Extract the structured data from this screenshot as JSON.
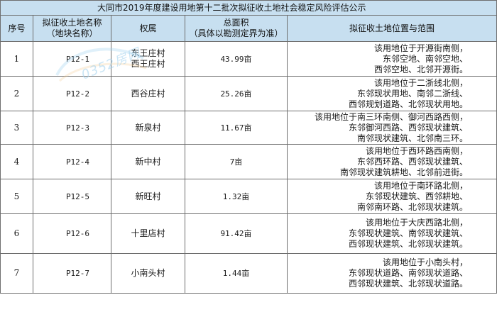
{
  "title": "大同市2019年度建设用地第十二批次拟征收土地社会稳定风险评估公示",
  "headers": {
    "no": "序号",
    "name_line1": "拟征收土地名称",
    "name_line2": "（地块名称）",
    "owner": "权属",
    "area_line1": "总面积",
    "area_line2": "（具体以勘测定界为准）",
    "location": "拟征收土地位置与范围"
  },
  "rows": [
    {
      "no": "1",
      "code": "P12-1",
      "villages": [
        "东王庄村",
        "西王庄村"
      ],
      "area": "43.99亩",
      "location": [
        "该用地位于开源街南侧，",
        "东邻空地、南邻空地、",
        "西邻空地、北邻开源街。"
      ]
    },
    {
      "no": "2",
      "code": "P12-2",
      "villages": [
        "西谷庄村"
      ],
      "area": "25.26亩",
      "location": [
        "该用地位于二浙线北侧，",
        "东邻现状用地、南邻二浙线、",
        "西邻规划道路、北邻现状用地。"
      ]
    },
    {
      "no": "3",
      "code": "P12-3",
      "villages": [
        "新泉村"
      ],
      "area": "11.67亩",
      "location": [
        "该用地位于南三环南侧、御河西路西侧，",
        "东邻御河西路、西邻现状建筑、",
        "南邻现状建筑、北邻南三环。"
      ]
    },
    {
      "no": "4",
      "code": "P12-4",
      "villages": [
        "新中村"
      ],
      "area": "7亩",
      "location": [
        "该用地位于西环路西南侧，",
        "东邻西环路、西邻现状建筑、",
        "南邻现状建筑耕地、北邻前进街。"
      ]
    },
    {
      "no": "5",
      "code": "P12-5",
      "villages": [
        "新旺村"
      ],
      "area": "1.32亩",
      "location": [
        "该用地位于南环路北侧，",
        "东邻现状建筑、西邻耕地、",
        "南邻南环路、北邻现状建筑。"
      ]
    },
    {
      "no": "6",
      "code": "P12-6",
      "villages": [
        "十里店村"
      ],
      "area": "91.42亩",
      "location": [
        "该用地位于大庆西路北侧，",
        "东邻现状建筑、南邻现状建筑、",
        "西邻现状建筑、北邻现状建筑。"
      ]
    },
    {
      "no": "7",
      "code": "P12-7",
      "villages": [
        "小南头村"
      ],
      "area": "1.44亩",
      "location": [
        "该用地位于小南头村，",
        "东邻现状道路、南邻现状道路、",
        "西邻现状建筑、北邻现状道路。"
      ]
    }
  ],
  "watermark": {
    "text": "0352房网",
    "url_text": "FANG.COM"
  },
  "colors": {
    "header_bg": "#c7dff0",
    "border": "#6e6e6e",
    "watermark": "#9fd0ee"
  }
}
